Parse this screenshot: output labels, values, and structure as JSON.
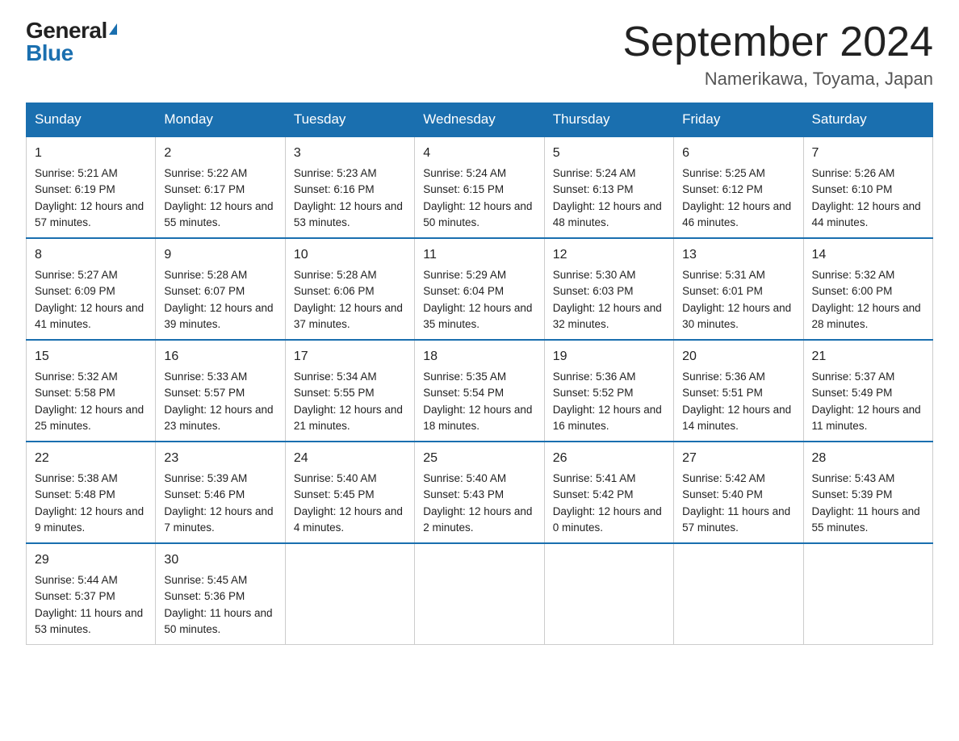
{
  "logo": {
    "general": "General",
    "blue": "Blue",
    "triangle": "▲"
  },
  "title": "September 2024",
  "subtitle": "Namerikawa, Toyama, Japan",
  "days": [
    "Sunday",
    "Monday",
    "Tuesday",
    "Wednesday",
    "Thursday",
    "Friday",
    "Saturday"
  ],
  "weeks": [
    [
      {
        "num": "1",
        "sunrise": "5:21 AM",
        "sunset": "6:19 PM",
        "daylight": "12 hours and 57 minutes."
      },
      {
        "num": "2",
        "sunrise": "5:22 AM",
        "sunset": "6:17 PM",
        "daylight": "12 hours and 55 minutes."
      },
      {
        "num": "3",
        "sunrise": "5:23 AM",
        "sunset": "6:16 PM",
        "daylight": "12 hours and 53 minutes."
      },
      {
        "num": "4",
        "sunrise": "5:24 AM",
        "sunset": "6:15 PM",
        "daylight": "12 hours and 50 minutes."
      },
      {
        "num": "5",
        "sunrise": "5:24 AM",
        "sunset": "6:13 PM",
        "daylight": "12 hours and 48 minutes."
      },
      {
        "num": "6",
        "sunrise": "5:25 AM",
        "sunset": "6:12 PM",
        "daylight": "12 hours and 46 minutes."
      },
      {
        "num": "7",
        "sunrise": "5:26 AM",
        "sunset": "6:10 PM",
        "daylight": "12 hours and 44 minutes."
      }
    ],
    [
      {
        "num": "8",
        "sunrise": "5:27 AM",
        "sunset": "6:09 PM",
        "daylight": "12 hours and 41 minutes."
      },
      {
        "num": "9",
        "sunrise": "5:28 AM",
        "sunset": "6:07 PM",
        "daylight": "12 hours and 39 minutes."
      },
      {
        "num": "10",
        "sunrise": "5:28 AM",
        "sunset": "6:06 PM",
        "daylight": "12 hours and 37 minutes."
      },
      {
        "num": "11",
        "sunrise": "5:29 AM",
        "sunset": "6:04 PM",
        "daylight": "12 hours and 35 minutes."
      },
      {
        "num": "12",
        "sunrise": "5:30 AM",
        "sunset": "6:03 PM",
        "daylight": "12 hours and 32 minutes."
      },
      {
        "num": "13",
        "sunrise": "5:31 AM",
        "sunset": "6:01 PM",
        "daylight": "12 hours and 30 minutes."
      },
      {
        "num": "14",
        "sunrise": "5:32 AM",
        "sunset": "6:00 PM",
        "daylight": "12 hours and 28 minutes."
      }
    ],
    [
      {
        "num": "15",
        "sunrise": "5:32 AM",
        "sunset": "5:58 PM",
        "daylight": "12 hours and 25 minutes."
      },
      {
        "num": "16",
        "sunrise": "5:33 AM",
        "sunset": "5:57 PM",
        "daylight": "12 hours and 23 minutes."
      },
      {
        "num": "17",
        "sunrise": "5:34 AM",
        "sunset": "5:55 PM",
        "daylight": "12 hours and 21 minutes."
      },
      {
        "num": "18",
        "sunrise": "5:35 AM",
        "sunset": "5:54 PM",
        "daylight": "12 hours and 18 minutes."
      },
      {
        "num": "19",
        "sunrise": "5:36 AM",
        "sunset": "5:52 PM",
        "daylight": "12 hours and 16 minutes."
      },
      {
        "num": "20",
        "sunrise": "5:36 AM",
        "sunset": "5:51 PM",
        "daylight": "12 hours and 14 minutes."
      },
      {
        "num": "21",
        "sunrise": "5:37 AM",
        "sunset": "5:49 PM",
        "daylight": "12 hours and 11 minutes."
      }
    ],
    [
      {
        "num": "22",
        "sunrise": "5:38 AM",
        "sunset": "5:48 PM",
        "daylight": "12 hours and 9 minutes."
      },
      {
        "num": "23",
        "sunrise": "5:39 AM",
        "sunset": "5:46 PM",
        "daylight": "12 hours and 7 minutes."
      },
      {
        "num": "24",
        "sunrise": "5:40 AM",
        "sunset": "5:45 PM",
        "daylight": "12 hours and 4 minutes."
      },
      {
        "num": "25",
        "sunrise": "5:40 AM",
        "sunset": "5:43 PM",
        "daylight": "12 hours and 2 minutes."
      },
      {
        "num": "26",
        "sunrise": "5:41 AM",
        "sunset": "5:42 PM",
        "daylight": "12 hours and 0 minutes."
      },
      {
        "num": "27",
        "sunrise": "5:42 AM",
        "sunset": "5:40 PM",
        "daylight": "11 hours and 57 minutes."
      },
      {
        "num": "28",
        "sunrise": "5:43 AM",
        "sunset": "5:39 PM",
        "daylight": "11 hours and 55 minutes."
      }
    ],
    [
      {
        "num": "29",
        "sunrise": "5:44 AM",
        "sunset": "5:37 PM",
        "daylight": "11 hours and 53 minutes."
      },
      {
        "num": "30",
        "sunrise": "5:45 AM",
        "sunset": "5:36 PM",
        "daylight": "11 hours and 50 minutes."
      },
      null,
      null,
      null,
      null,
      null
    ]
  ]
}
